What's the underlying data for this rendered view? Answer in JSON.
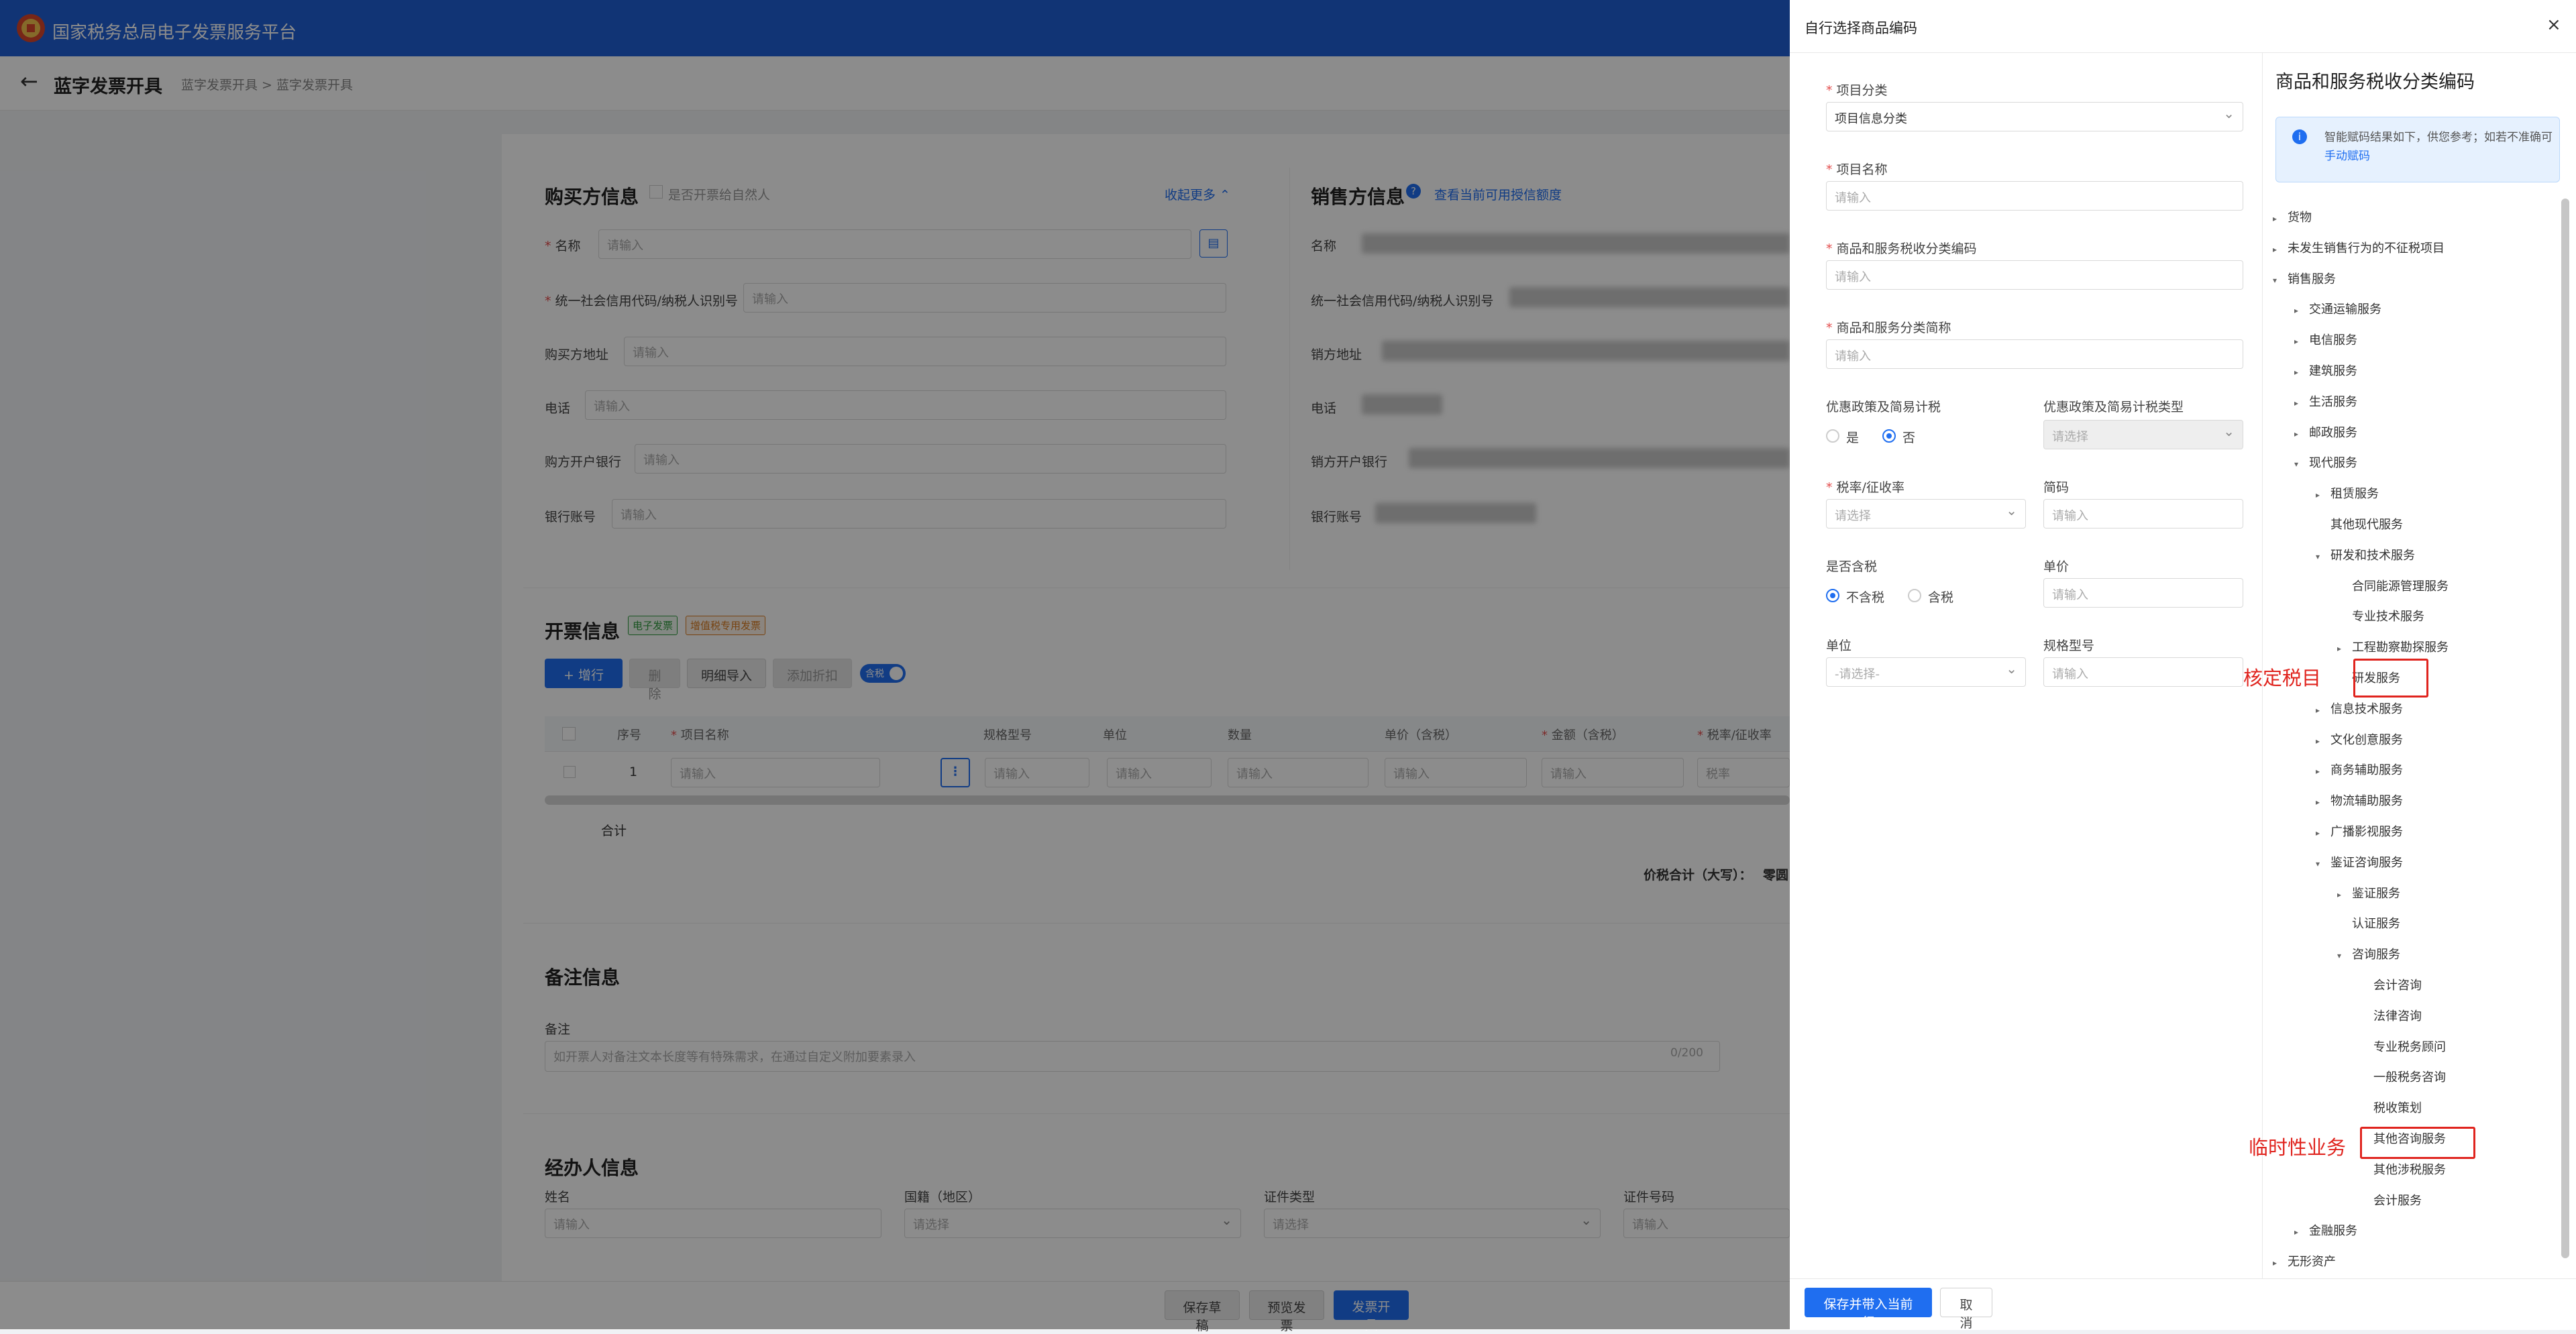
{
  "header": {
    "site_title": "国家税务总局电子发票服务平台",
    "page_title": "蓝字发票开具",
    "breadcrumb": "蓝字发票开具 > 蓝字发票开具"
  },
  "buyer": {
    "title": "购买方信息",
    "natural_person_label": "是否开票给自然人",
    "collapse_label": "收起更多",
    "fields": {
      "name": "名称",
      "tax_id": "统一社会信用代码/纳税人识别号",
      "address": "购买方地址",
      "phone": "电话",
      "bank": "购方开户银行",
      "account": "银行账号"
    },
    "placeholder": "请输入"
  },
  "seller": {
    "title": "销售方信息",
    "quota_link": "查看当前可用授信额度",
    "fields": {
      "name": "名称",
      "tax_id": "统一社会信用代码/纳税人识别号",
      "address": "销方地址",
      "phone": "电话",
      "bank": "销方开户银行",
      "account": "银行账号"
    }
  },
  "invoice": {
    "title": "开票信息",
    "tag_electronic": "电子发票",
    "tag_special": "增值税专用发票",
    "buttons": {
      "add_row": "+ 增行",
      "delete": "删除",
      "import_detail": "明细导入",
      "add_discount": "添加折扣",
      "tax_incl": "含税"
    },
    "columns": [
      "序号",
      "项目名称",
      "规格型号",
      "单位",
      "数量",
      "单价（含税）",
      "金额（含税）",
      "税率/征收率"
    ],
    "row_index": "1",
    "placeholder": "请输入",
    "tax_placeholder": "税率",
    "total_label": "合计",
    "total_amount_label": "价税合计（大写）：",
    "total_amount_value": "零圆"
  },
  "remarks": {
    "title": "备注信息",
    "field_label": "备注",
    "placeholder": "如开票人对备注文本长度等有特殊需求，在通过自定义附加要素录入",
    "counter": "0/200"
  },
  "handler": {
    "title": "经办人信息",
    "name_label": "姓名",
    "nationality_label": "国籍（地区）",
    "id_type_label": "证件类型",
    "id_no_label": "证件号码",
    "input_placeholder": "请输入",
    "select_placeholder": "请选择"
  },
  "footer": {
    "save_draft": "保存草稿",
    "preview": "预览发票",
    "issue": "发票开具"
  },
  "drawer": {
    "title": "自行选择商品编码",
    "close": "×",
    "fields": {
      "category_label": "项目分类",
      "category_value": "项目信息分类",
      "item_name_label": "项目名称",
      "tax_code_label": "商品和服务税收分类编码",
      "tax_short_label": "商品和服务分类简称",
      "preferential_label": "优惠政策及简易计税",
      "pref_yes": "是",
      "pref_no": "否",
      "pref_type_label": "优惠政策及简易计税类型",
      "pref_type_placeholder": "请选择",
      "rate_label": "税率/征收率",
      "rate_placeholder": "请选择",
      "short_code_label": "简码",
      "tax_included_label": "是否含税",
      "tax_excl": "不含税",
      "tax_incl": "含税",
      "unit_price_label": "单价",
      "unit_label": "单位",
      "unit_placeholder": "-请选择-",
      "spec_label": "规格型号",
      "input_placeholder": "请输入"
    },
    "tree_title": "商品和服务税收分类编码",
    "info_text": "智能赋码结果如下，供您参考；如若不准确可",
    "info_link": "手动赋码",
    "tree": [
      {
        "label": "货物",
        "arrow": "▸",
        "level": 0
      },
      {
        "label": "未发生销售行为的不征税项目",
        "arrow": "▸",
        "level": 0
      },
      {
        "label": "销售服务",
        "arrow": "▾",
        "level": 0
      },
      {
        "label": "交通运输服务",
        "arrow": "▸",
        "level": 1
      },
      {
        "label": "电信服务",
        "arrow": "▸",
        "level": 1
      },
      {
        "label": "建筑服务",
        "arrow": "▸",
        "level": 1
      },
      {
        "label": "生活服务",
        "arrow": "▸",
        "level": 1
      },
      {
        "label": "邮政服务",
        "arrow": "▸",
        "level": 1
      },
      {
        "label": "现代服务",
        "arrow": "▾",
        "level": 1
      },
      {
        "label": "租赁服务",
        "arrow": "▸",
        "level": 2
      },
      {
        "label": "其他现代服务",
        "arrow": "",
        "level": 2
      },
      {
        "label": "研发和技术服务",
        "arrow": "▾",
        "level": 2
      },
      {
        "label": "合同能源管理服务",
        "arrow": "",
        "level": 3
      },
      {
        "label": "专业技术服务",
        "arrow": "",
        "level": 3
      },
      {
        "label": "工程勘察勘探服务",
        "arrow": "▸",
        "level": 3
      },
      {
        "label": "研发服务",
        "arrow": "",
        "level": 3
      },
      {
        "label": "信息技术服务",
        "arrow": "▸",
        "level": 2
      },
      {
        "label": "文化创意服务",
        "arrow": "▸",
        "level": 2
      },
      {
        "label": "商务辅助服务",
        "arrow": "▸",
        "level": 2
      },
      {
        "label": "物流辅助服务",
        "arrow": "▸",
        "level": 2
      },
      {
        "label": "广播影视服务",
        "arrow": "▸",
        "level": 2
      },
      {
        "label": "鉴证咨询服务",
        "arrow": "▾",
        "level": 2
      },
      {
        "label": "鉴证服务",
        "arrow": "▸",
        "level": 3
      },
      {
        "label": "认证服务",
        "arrow": "",
        "level": 3
      },
      {
        "label": "咨询服务",
        "arrow": "▾",
        "level": 3
      },
      {
        "label": "会计咨询",
        "arrow": "",
        "level": 4
      },
      {
        "label": "法律咨询",
        "arrow": "",
        "level": 4
      },
      {
        "label": "专业税务顾问",
        "arrow": "",
        "level": 4
      },
      {
        "label": "一般税务咨询",
        "arrow": "",
        "level": 4
      },
      {
        "label": "税收策划",
        "arrow": "",
        "level": 4
      },
      {
        "label": "其他咨询服务",
        "arrow": "",
        "level": 4
      },
      {
        "label": "其他涉税服务",
        "arrow": "",
        "level": 4
      },
      {
        "label": "会计服务",
        "arrow": "",
        "level": 4
      },
      {
        "label": "金融服务",
        "arrow": "▸",
        "level": 1
      },
      {
        "label": "无形资产",
        "arrow": "▸",
        "level": 0
      }
    ],
    "annotations": {
      "rd": "核定税目",
      "temp": "临时性业务"
    },
    "footer": {
      "save": "保存并带入当前行",
      "cancel": "取消"
    }
  },
  "colors": {
    "primary": "#1f6ef0",
    "header": "#1f5fd6",
    "annotation": "#e0241e"
  }
}
